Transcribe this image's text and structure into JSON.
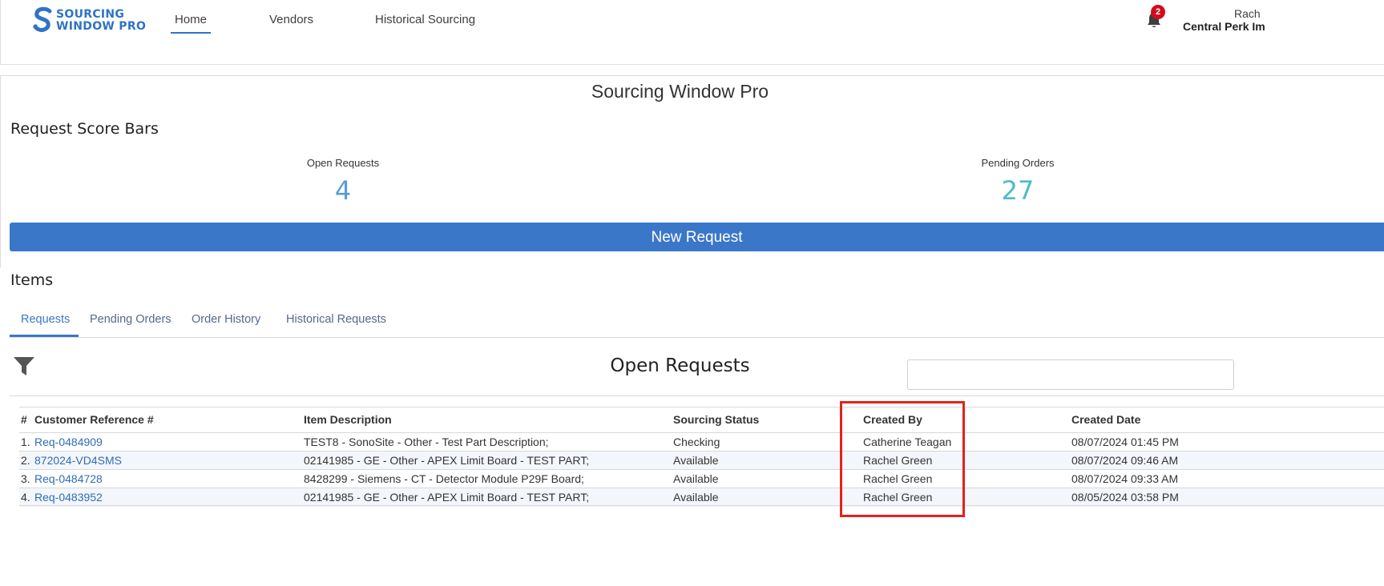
{
  "header": {
    "logo_line1": "SOURCING",
    "logo_line2": "WINDOW PRO",
    "nav": [
      "Home",
      "Vendors",
      "Historical Sourcing"
    ],
    "active_nav": "Home",
    "notification_count": "2",
    "user_name": "Rach",
    "user_org": "Central Perk Im"
  },
  "page_title": "Sourcing Window Pro",
  "score_section": {
    "title": "Request Score Bars",
    "open_requests_label": "Open Requests",
    "open_requests_value": "4",
    "pending_orders_label": "Pending Orders",
    "pending_orders_value": "27"
  },
  "new_request_label": "New Request",
  "items": {
    "title": "Items",
    "tabs": [
      "Requests",
      "Pending Orders",
      "Order History",
      "Historical Requests"
    ],
    "active_tab": "Requests"
  },
  "open_requests": {
    "title": "Open Requests",
    "search_value": "",
    "columns": [
      "#",
      "Customer Reference #",
      "Item Description",
      "Sourcing Status",
      "Created By",
      "Created Date"
    ],
    "rows": [
      {
        "num": "1.",
        "ref": "Req-0484909",
        "desc": "TEST8 - SonoSite - Other - Test Part Description;",
        "status": "Checking",
        "created_by": "Catherine Teagan",
        "created_date": "08/07/2024 01:45 PM"
      },
      {
        "num": "2.",
        "ref": "872024-VD4SMS",
        "desc": "02141985 - GE - Other - APEX Limit Board - TEST PART;",
        "status": "Available",
        "created_by": "Rachel Green",
        "created_date": "08/07/2024 09:46 AM"
      },
      {
        "num": "3.",
        "ref": "Req-0484728",
        "desc": "8428299 - Siemens - CT - Detector Module P29F Board;",
        "status": "Available",
        "created_by": "Rachel Green",
        "created_date": "08/07/2024 09:33 AM"
      },
      {
        "num": "4.",
        "ref": "Req-0483952",
        "desc": "02141985 - GE - Other - APEX Limit Board - TEST PART;",
        "status": "Available",
        "created_by": "Rachel Green",
        "created_date": "08/05/2024 03:58 PM"
      }
    ]
  },
  "colors": {
    "brand_blue": "#2f73c4",
    "button_blue": "#3b77c9",
    "open_requests_color": "#5a9bd5",
    "pending_orders_color": "#4bbdc8",
    "badge_red": "#d20b1c",
    "highlight_red": "#e2231a"
  },
  "icons": [
    "logo-s-icon",
    "bell-icon",
    "filter-icon"
  ]
}
